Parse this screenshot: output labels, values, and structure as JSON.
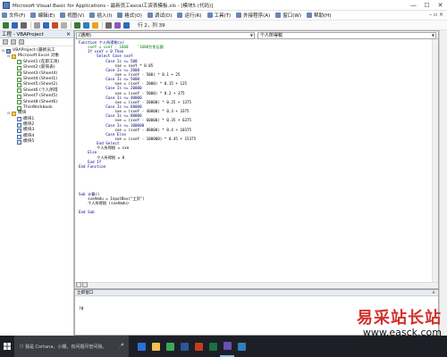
{
  "window": {
    "title": "Microsoft Visual Basic for Applications - 最新员工excel工资表模板.xls - [模块5 (代码)]",
    "controls": [
      "—",
      "☐",
      "✕"
    ]
  },
  "menu": {
    "items": [
      {
        "label": "文件(F)",
        "icon": "file-menu-icon"
      },
      {
        "label": "编辑(E)",
        "icon": "edit-menu-icon"
      },
      {
        "label": "视图(V)",
        "icon": "view-menu-icon"
      },
      {
        "label": "插入(I)",
        "icon": "insert-menu-icon"
      },
      {
        "label": "格式(O)",
        "icon": "format-menu-icon"
      },
      {
        "label": "调试(D)",
        "icon": "debug-menu-icon"
      },
      {
        "label": "运行(R)",
        "icon": "run-menu-icon"
      },
      {
        "label": "工具(T)",
        "icon": "tools-menu-icon"
      },
      {
        "label": "外接程序(A)",
        "icon": "addins-menu-icon"
      },
      {
        "label": "窗口(W)",
        "icon": "window-menu-icon"
      },
      {
        "label": "帮助(H)",
        "icon": "help-menu-icon"
      }
    ],
    "right_controls": "– ▫ ×"
  },
  "toolbar": {
    "position": "行 2，列 39",
    "colors": [
      "#3b7a3b",
      "#2e6bb8",
      "#666666",
      "#9c9c9c",
      "#2e6bb8",
      "#c94a2a",
      "#b0b0b0",
      "#3b7a3b",
      "#2f7fbd",
      "#e6a427",
      "#6a6a6a",
      "#8a5bbd",
      "#2e6bb8"
    ]
  },
  "project": {
    "title": "工程 - VBAProject",
    "close": "×",
    "tree": [
      {
        "label": "VBAProject (最新员工",
        "level": 0,
        "icon": "proj",
        "expander": "⊟"
      },
      {
        "label": "Microsoft Excel 对象",
        "level": 1,
        "icon": "folder",
        "expander": "⊟"
      },
      {
        "label": "Sheet1 (在职工资)",
        "level": 2,
        "icon": "sheet",
        "expander": ""
      },
      {
        "label": "Sheet2 (薪资表)",
        "level": 2,
        "icon": "sheet",
        "expander": ""
      },
      {
        "label": "Sheet3 (Sheet4)",
        "level": 2,
        "icon": "sheet",
        "expander": ""
      },
      {
        "label": "Sheet4 (Sheet1)",
        "level": 2,
        "icon": "sheet",
        "expander": ""
      },
      {
        "label": "Sheet5 (Sheet2)",
        "level": 2,
        "icon": "sheet",
        "expander": ""
      },
      {
        "label": "Sheet6 (个人所得",
        "level": 2,
        "icon": "sheet",
        "expander": ""
      },
      {
        "label": "Sheet7 (Sheet5)",
        "level": 2,
        "icon": "sheet",
        "expander": ""
      },
      {
        "label": "Sheet8 (Sheet6)",
        "level": 2,
        "icon": "sheet",
        "expander": ""
      },
      {
        "label": "ThisWorkbook",
        "level": 2,
        "icon": "sheet",
        "expander": ""
      },
      {
        "label": "模块",
        "level": 1,
        "icon": "folder",
        "expander": "⊟"
      },
      {
        "label": "模块1",
        "level": 2,
        "icon": "mod",
        "expander": ""
      },
      {
        "label": "模块2",
        "level": 2,
        "icon": "mod",
        "expander": ""
      },
      {
        "label": "模块3",
        "level": 2,
        "icon": "mod",
        "expander": ""
      },
      {
        "label": "模块4",
        "level": 2,
        "icon": "mod",
        "expander": ""
      },
      {
        "label": "模块5",
        "level": 2,
        "icon": "mod",
        "expander": ""
      }
    ]
  },
  "code": {
    "object_combo": "(通用)",
    "procedure_combo": "个人所得税",
    "lines": [
      {
        "t": "Function 个人所得税(x)",
        "k": "kw"
      },
      {
        "t": "    sxeY = sxeY - 1600    '1600为免征额",
        "k": "cm"
      },
      {
        "t": "    If sxeY > 0 Then",
        "k": "kw"
      },
      {
        "t": "        Select Case sxeY",
        "k": "kw"
      },
      {
        "t": "            Case Is <= 500",
        "k": "kw"
      },
      {
        "t": "                sxe = sxeY * 0.05",
        "k": ""
      },
      {
        "t": "            Case Is <= 2000",
        "k": "kw"
      },
      {
        "t": "                sxe = (sxeY - 500) * 0.1 + 25",
        "k": ""
      },
      {
        "t": "            Case Is <= 5000",
        "k": "kw"
      },
      {
        "t": "                sxe = (sxeY - 2000) * 0.15 + 125",
        "k": ""
      },
      {
        "t": "            Case Is <= 20000",
        "k": "kw"
      },
      {
        "t": "                sxe = (sxeY - 5000) * 0.2 + 375",
        "k": ""
      },
      {
        "t": "            Case Is <= 40000",
        "k": "kw"
      },
      {
        "t": "                sxe = (sxeY - 20000) * 0.25 + 1375",
        "k": ""
      },
      {
        "t": "            Case Is <= 60000",
        "k": "kw"
      },
      {
        "t": "                sxe = (sxeY - 40000) * 0.3 + 3375",
        "k": ""
      },
      {
        "t": "            Case Is <= 80000",
        "k": "kw"
      },
      {
        "t": "                sxe = (sxeY - 60000) * 0.35 + 6375",
        "k": ""
      },
      {
        "t": "            Case Is <= 100000",
        "k": "kw"
      },
      {
        "t": "                sxe = (sxeY - 80000) * 0.4 + 10375",
        "k": ""
      },
      {
        "t": "            Case Else",
        "k": "kw"
      },
      {
        "t": "                sxe = (sxeY - 100000) * 0.45 + 15375",
        "k": ""
      },
      {
        "t": "        End Select",
        "k": "kw"
      },
      {
        "t": "        个人所得税 = sxe",
        "k": ""
      },
      {
        "t": "    Else",
        "k": "kw"
      },
      {
        "t": "        个人所得税 = 0",
        "k": ""
      },
      {
        "t": "    End If",
        "k": "kw"
      },
      {
        "t": "End Function",
        "k": "kw"
      },
      {
        "t": "",
        "k": ""
      },
      {
        "t": "",
        "k": ""
      },
      {
        "t": "",
        "k": ""
      },
      {
        "t": "",
        "k": ""
      },
      {
        "t": "",
        "k": ""
      },
      {
        "t": "Sub 计算()",
        "k": "kw"
      },
      {
        "t": "    sxeAmdu = InputBox(\"工资\")",
        "k": ""
      },
      {
        "t": "    个人所得税 (sxeAmdu)",
        "k": ""
      },
      {
        "t": "",
        "k": ""
      },
      {
        "t": "End Sub",
        "k": "kw"
      }
    ]
  },
  "immediate": {
    "title": "立即窗口",
    "close": "×",
    "value": "?0"
  },
  "taskbar": {
    "search_placeholder": "我是 Cortana，小娜。有问题尽管问我。",
    "apps": [
      "#2b6fd6",
      "#f2c14e",
      "#3aa757",
      "#2b579a",
      "#c43e1c",
      "#1d6f42",
      "#6a4fb3",
      "#2f7fbd"
    ]
  },
  "watermark": {
    "text_cn": "易采站长站",
    "url": "www.easck.com"
  }
}
